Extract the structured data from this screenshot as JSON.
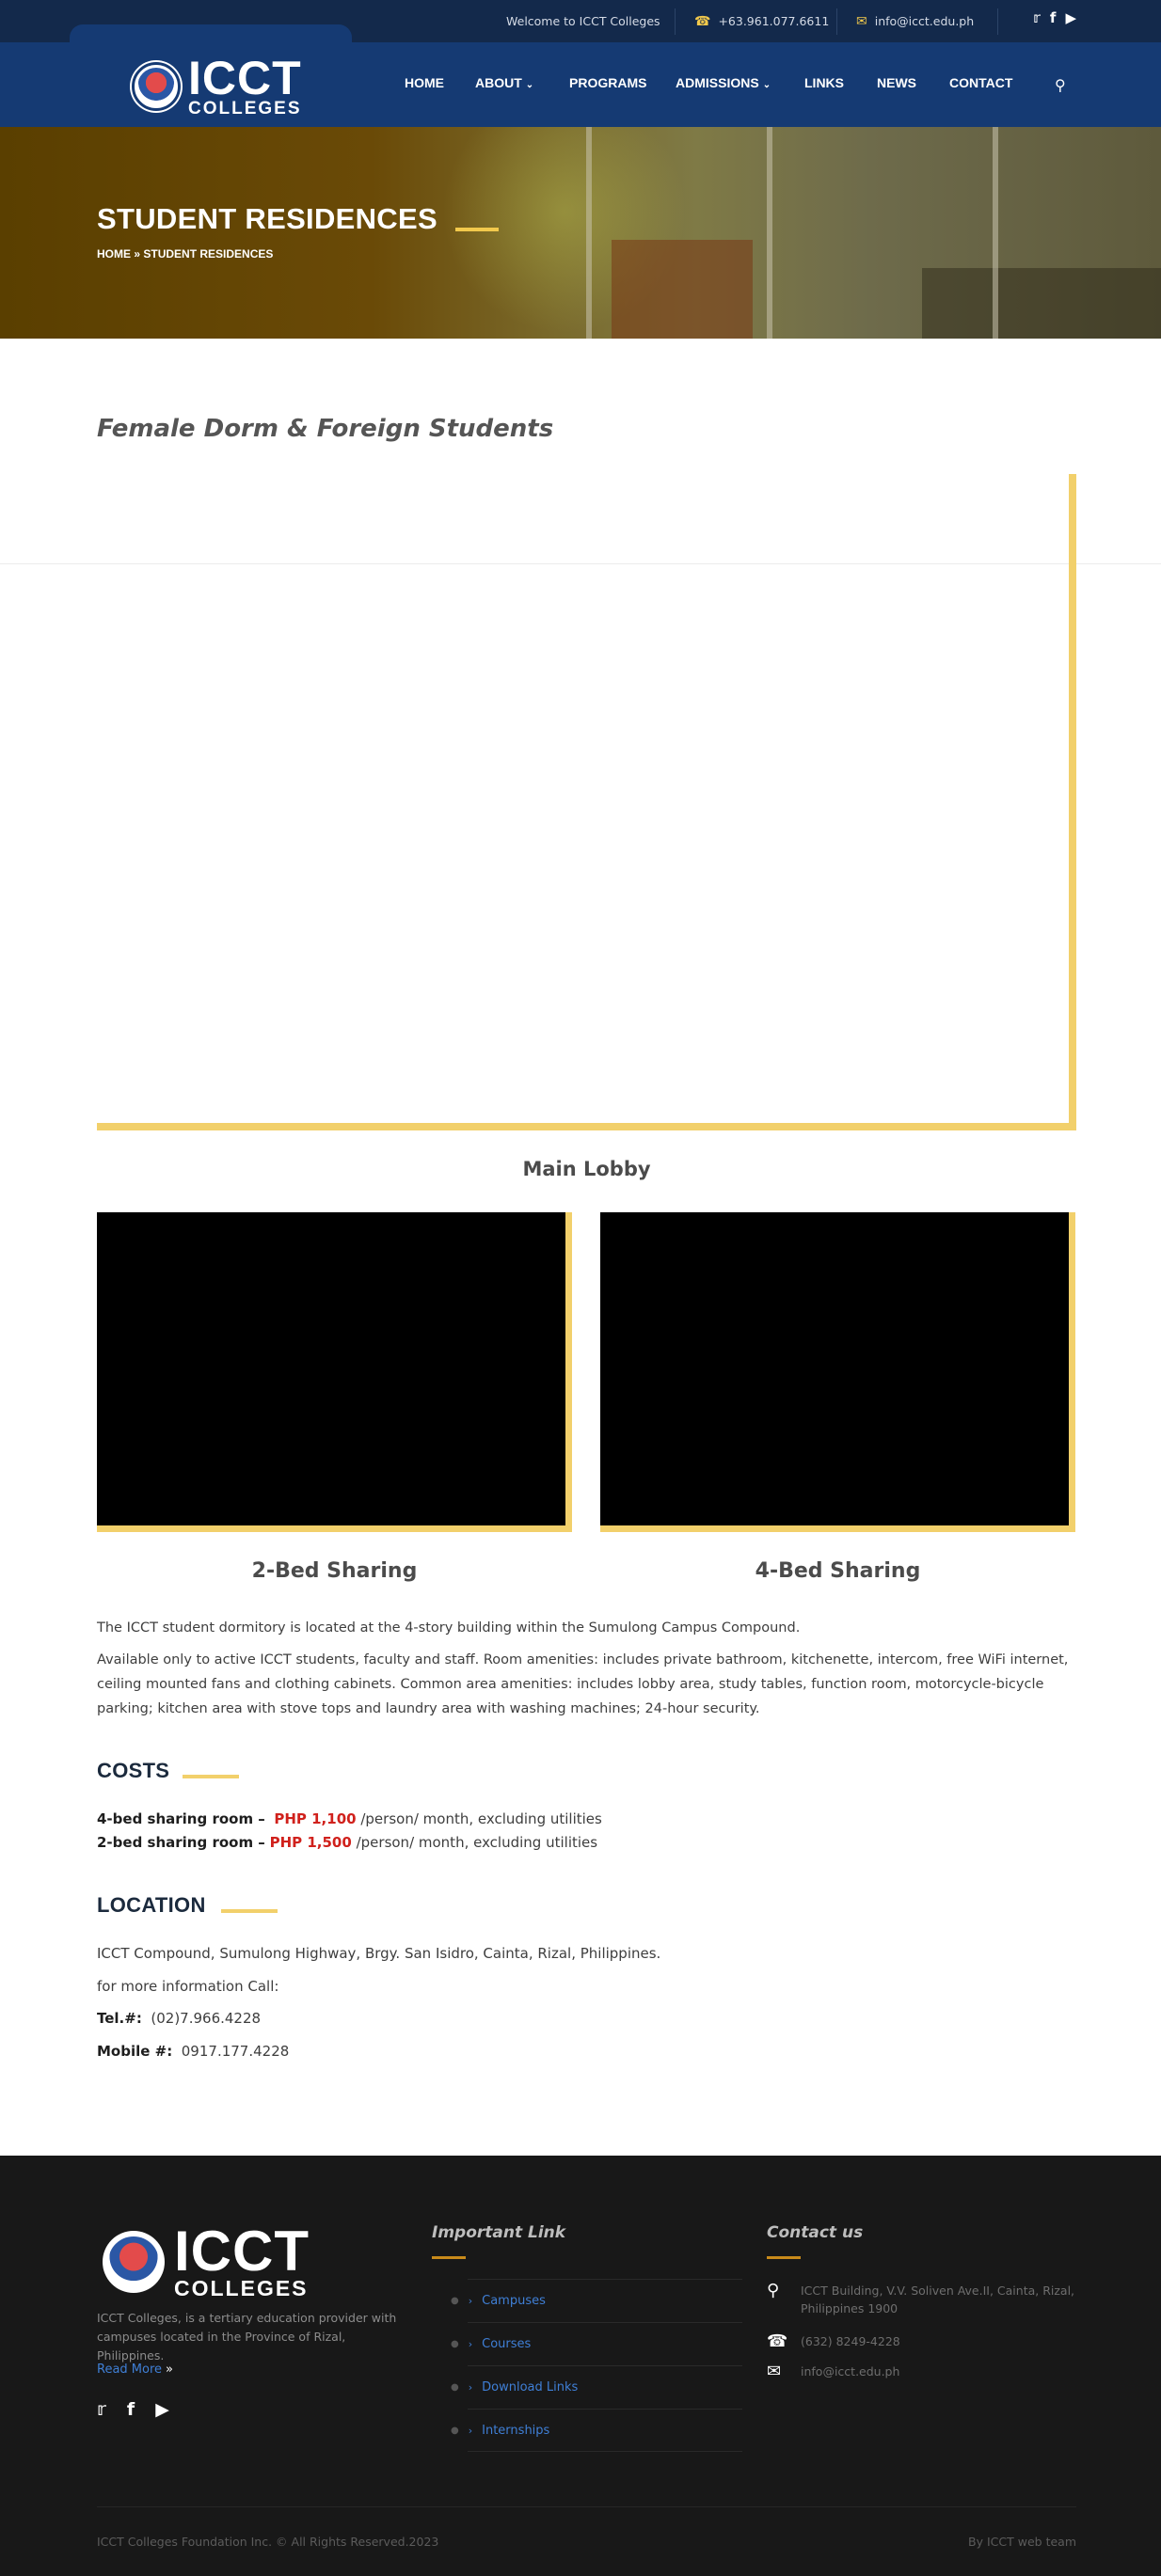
{
  "topbar": {
    "welcome": "Welcome to ICCT Colleges",
    "phone": "+63.961.077.6611",
    "email": "info@icct.edu.ph",
    "social": [
      "twitter-icon",
      "facebook-icon",
      "youtube-icon"
    ]
  },
  "header": {
    "logo_big": "ICCT",
    "logo_small": "COLLEGES",
    "nav": [
      {
        "label": "HOME"
      },
      {
        "label": "ABOUT"
      },
      {
        "label": "PROGRAMS"
      },
      {
        "label": "ADMISSIONS"
      },
      {
        "label": "LINKS"
      },
      {
        "label": "NEWS"
      },
      {
        "label": "CONTACT"
      }
    ]
  },
  "hero": {
    "title": "STUDENT RESIDENCES",
    "breadcrumb_home": "HOME",
    "breadcrumb_sep": "»",
    "breadcrumb_current": "STUDENT RESIDENCES"
  },
  "content": {
    "subtitle": "Female Dorm & Foreign Students",
    "main_caption": "Main Lobby",
    "video_captions": [
      "2-Bed Sharing",
      "4-Bed Sharing"
    ],
    "para1": "The ICCT student dormitory is located at the 4-story building within the Sumulong Campus Compound.",
    "para2": "Available only to active ICCT students, faculty and staff. Room amenities: includes private bathroom, kitchenette, intercom, free WiFi internet, ceiling mounted fans and clothing cabinets. Common area amenities: includes lobby area, study tables, function room, motorcycle-bicycle parking; kitchen area with stove tops and laundry area with washing machines; 24-hour security.",
    "costs_heading": "COSTS",
    "costs": [
      {
        "label": "4-bed sharing room –",
        "price": "PHP 1,100",
        "suffix": "/person/ month, excluding utilities"
      },
      {
        "label": "2-bed sharing room –",
        "price": "PHP 1,500",
        "suffix": "/person/ month, excluding utilities"
      }
    ],
    "location_heading": "LOCATION",
    "address": "ICCT Compound, Sumulong Highway, Brgy. San Isidro, Cainta, Rizal, Philippines.",
    "more_info": "for more information Call:",
    "tel_label": "Tel.#:",
    "tel_value": "(02)7.966.4228",
    "mobile_label": "Mobile #:",
    "mobile_value": "0917.177.4228"
  },
  "footer": {
    "logo_big": "ICCT",
    "logo_small": "COLLEGES",
    "description": "ICCT Colleges, is a tertiary education provider with campuses located in the Province of Rizal, Philippines.",
    "read_more": "Read More",
    "important_heading": "Important Link",
    "links": [
      "Campuses",
      "Courses",
      "Download Links",
      "Internships"
    ],
    "contact_heading": "Contact us",
    "contact_address": "ICCT Building, V.V. Soliven Ave.II, Cainta, Rizal, Philippines 1900",
    "contact_phone": "(632) 8249-4228",
    "contact_email": "info@icct.edu.ph",
    "copyright": "ICCT Colleges Foundation Inc. © All Rights Reserved.2023",
    "by": "By ICCT web team"
  },
  "colors": {
    "topbar": "#13294b",
    "header": "#153a73",
    "accent": "#f2d06b",
    "price": "#d0211c",
    "footer": "#181818",
    "link": "#3f7fd6"
  }
}
